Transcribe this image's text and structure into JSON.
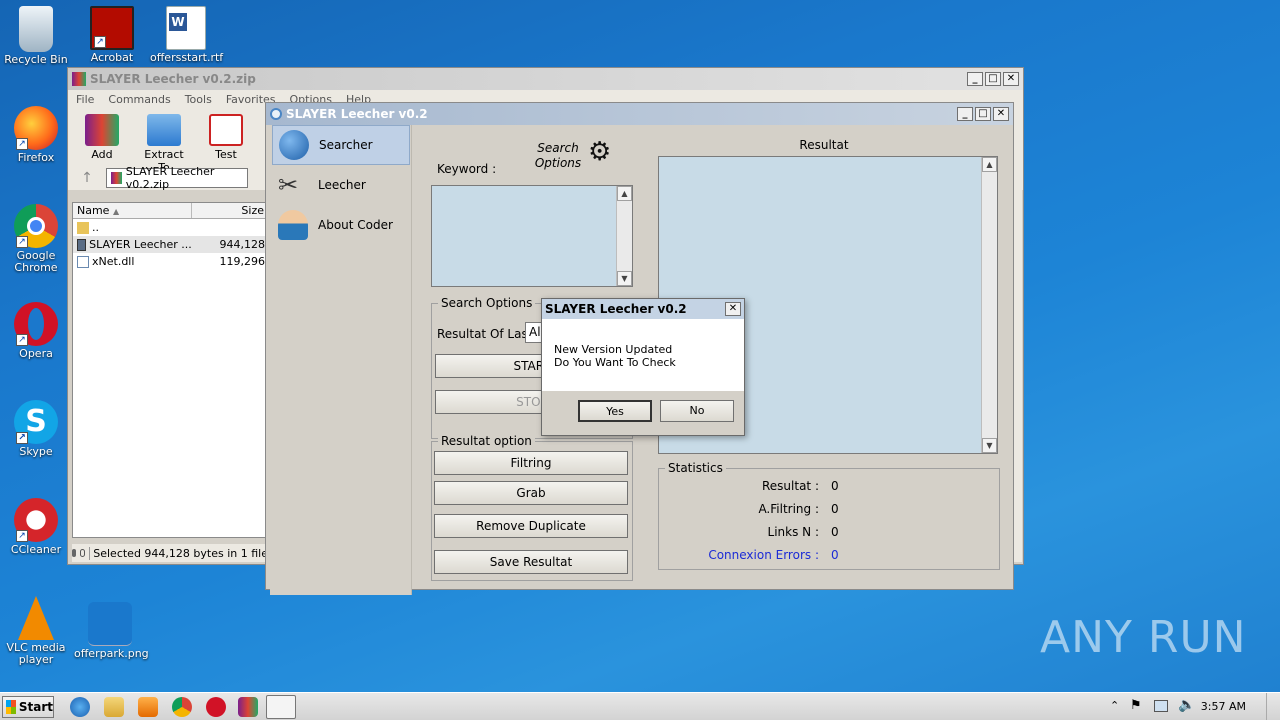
{
  "desktop": {
    "icons": [
      {
        "label": "Recycle Bin"
      },
      {
        "label": "Firefox"
      },
      {
        "label": "Google Chrome"
      },
      {
        "label": "Opera"
      },
      {
        "label": "Skype"
      },
      {
        "label": "CCleaner"
      },
      {
        "label": "VLC media player"
      },
      {
        "label": "Acrobat"
      },
      {
        "label": "offersstart.rtf"
      },
      {
        "label": "offerpark.png"
      }
    ]
  },
  "winrar": {
    "title": "SLAYER Leecher v0.2.zip",
    "menu": [
      "File",
      "Commands",
      "Tools",
      "Favorites",
      "Options",
      "Help"
    ],
    "toolbar": [
      "Add",
      "Extract To",
      "Test"
    ],
    "path": "SLAYER Leecher v0.2.zip",
    "columns": {
      "name": "Name",
      "size": "Size"
    },
    "files": [
      {
        "name": "..",
        "size": ""
      },
      {
        "name": "SLAYER Leecher ...",
        "size": "944,128"
      },
      {
        "name": "xNet.dll",
        "size": "119,296"
      }
    ],
    "status": "Selected 944,128 bytes in 1 file"
  },
  "slayer": {
    "title": "SLAYER Leecher v0.2",
    "nav": [
      "Searcher",
      "Leecher",
      "About Coder"
    ],
    "keyword_label": "Keyword :",
    "search_options_heading": "Search Options",
    "search_options_group": "Search Options",
    "resultat_of_last_label": "Resultat Of Last",
    "resultat_of_last_value": "All",
    "start_button": "START",
    "stop_button": "STOP",
    "resultat_option_group": "Resultat option",
    "option_buttons": [
      "Filtring",
      "Grab",
      "Remove Duplicate",
      "Save Resultat"
    ],
    "resultat_heading": "Resultat",
    "statistics_group": "Statistics",
    "stats": [
      {
        "label": "Resultat :",
        "value": "0",
        "color": "#000000"
      },
      {
        "label": "A.Filtring :",
        "value": "0",
        "color": "#000000"
      },
      {
        "label": "Links N :",
        "value": "0",
        "color": "#000000"
      },
      {
        "label": "Connexion Errors :",
        "value": "0",
        "color": "#1b2bd6"
      }
    ]
  },
  "dialog": {
    "title": "SLAYER Leecher v0.2",
    "line1": "New Version Updated",
    "line2": "Do You Want To Check",
    "yes": "Yes",
    "no": "No"
  },
  "taskbar": {
    "start": "Start",
    "clock": "3:57 AM"
  },
  "watermark": "ANY RUN"
}
